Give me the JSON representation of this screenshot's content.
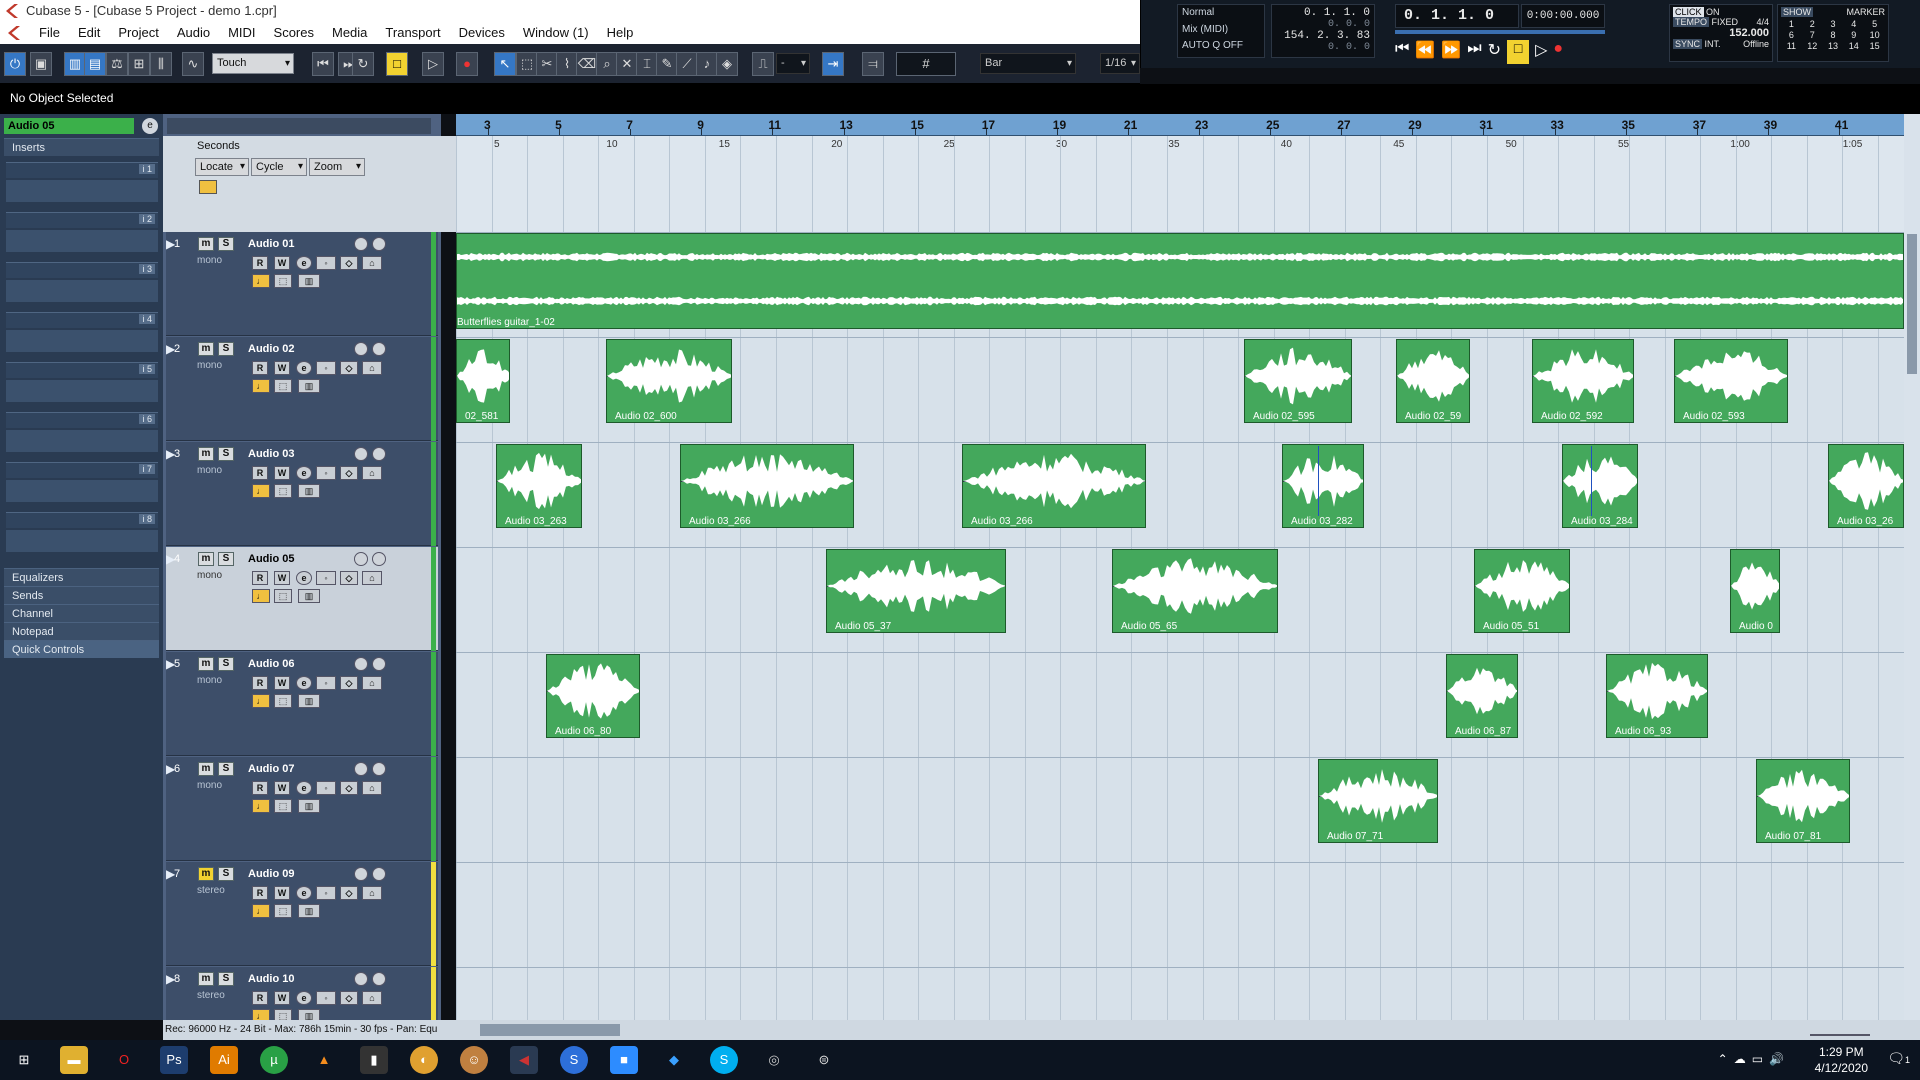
{
  "window_title": "Cubase 5 - [Cubase 5 Project - demo 1.cpr]",
  "menu": [
    "File",
    "Edit",
    "Project",
    "Audio",
    "MIDI",
    "Scores",
    "Media",
    "Transport",
    "Devices",
    "Window (1)",
    "Help"
  ],
  "toolbar": {
    "automation_mode": "Touch",
    "grid_type": "Bar",
    "quantize": "1/16",
    "quantize_dash": "-"
  },
  "transport": {
    "mode": "Normal",
    "mix": "Mix (MIDI)",
    "auto_q": "AUTO Q",
    "auto_q_state": "OFF",
    "left_locator": "0. 1. 1.   0",
    "left_sub": "0.   0.   0",
    "right_locator": "154.  2.  3. 83",
    "right_sub": "0.   0.   0",
    "position_bars": "0.  1.  1.    0",
    "position_time": "0:00:00.000",
    "click_label": "CLICK",
    "click_state": "ON",
    "tempo_label": "TEMPO",
    "tempo_mode": "FIXED",
    "signature": "4/4",
    "tempo": "152.000",
    "sync_label": "SYNC",
    "sync_mode": "INT.",
    "sync_state": "Offline",
    "show_label": "SHOW",
    "marker_label": "MARKER",
    "markers": [
      "1",
      "2",
      "3",
      "4",
      "5",
      "6",
      "7",
      "8",
      "9",
      "10",
      "11",
      "12",
      "13",
      "14",
      "15"
    ]
  },
  "status": "No Object Selected",
  "inspector": {
    "track_name": "Audio 05",
    "inserts_label": "Inserts",
    "slots": [
      "i 1",
      "i 2",
      "i 3",
      "i 4",
      "i 5",
      "i 6",
      "i 7",
      "i 8"
    ],
    "sections": [
      "Equalizers",
      "Sends",
      "Channel",
      "Notepad",
      "Quick Controls"
    ]
  },
  "ruler": {
    "bars": [
      "3",
      "5",
      "7",
      "9",
      "11",
      "13",
      "15",
      "17",
      "19",
      "21",
      "23",
      "25",
      "27",
      "29",
      "31",
      "33",
      "35",
      "37",
      "39",
      "41"
    ],
    "seconds": [
      "5",
      "10",
      "15",
      "20",
      "25",
      "30",
      "35",
      "40",
      "45",
      "50",
      "55",
      "1:00",
      "1:05"
    ],
    "seconds_label": "Seconds",
    "locate": "Locate",
    "cycle": "Cycle",
    "zoom": "Zoom"
  },
  "tracks": [
    {
      "num": "1",
      "name": "Audio 01",
      "type": "mono",
      "color": "#3bb04a"
    },
    {
      "num": "2",
      "name": "Audio 02",
      "type": "mono",
      "color": "#3bb04a"
    },
    {
      "num": "3",
      "name": "Audio 03",
      "type": "mono",
      "color": "#3bb04a"
    },
    {
      "num": "4",
      "name": "Audio 05",
      "type": "mono",
      "color": "#3bb04a"
    },
    {
      "num": "5",
      "name": "Audio 06",
      "type": "mono",
      "color": "#3bb04a"
    },
    {
      "num": "6",
      "name": "Audio 07",
      "type": "mono",
      "color": "#3bb04a"
    },
    {
      "num": "7",
      "name": "Audio 09",
      "type": "stereo",
      "color": "#f2e040"
    },
    {
      "num": "8",
      "name": "Audio 10",
      "type": "stereo",
      "color": "#f2e040"
    }
  ],
  "events": [
    {
      "lane": 0,
      "name": "Butterflies guitar_1-02"
    },
    {
      "lane": 1,
      "name": "02_581"
    },
    {
      "lane": 1,
      "name": "Audio 02_600"
    },
    {
      "lane": 1,
      "name": "Audio 02_595"
    },
    {
      "lane": 1,
      "name": "Audio 02_59"
    },
    {
      "lane": 1,
      "name": "Audio 02_592"
    },
    {
      "lane": 1,
      "name": "Audio 02_593"
    },
    {
      "lane": 2,
      "name": "Audio 03_263"
    },
    {
      "lane": 2,
      "name": "Audio 03_266"
    },
    {
      "lane": 2,
      "name": "Audio 03_266"
    },
    {
      "lane": 2,
      "name": "Audio 03_282"
    },
    {
      "lane": 2,
      "name": "Audio 03_284"
    },
    {
      "lane": 2,
      "name": "Audio 03_26"
    },
    {
      "lane": 3,
      "name": "Audio 05_37"
    },
    {
      "lane": 3,
      "name": "Audio 05_65"
    },
    {
      "lane": 3,
      "name": "Audio 05_51"
    },
    {
      "lane": 3,
      "name": "Audio 0"
    },
    {
      "lane": 4,
      "name": "Audio 06_80"
    },
    {
      "lane": 4,
      "name": "Audio 06_87"
    },
    {
      "lane": 4,
      "name": "Audio 06_93"
    },
    {
      "lane": 5,
      "name": "Audio 07_71"
    },
    {
      "lane": 5,
      "name": "Audio 07_81"
    }
  ],
  "status_bar": "Rec: 96000 Hz - 24 Bit - Max: 786h 15min - 30 fps - Pan: Equ",
  "taskbar": {
    "time": "1:29 PM",
    "date": "4/12/2020",
    "notifications": "1"
  }
}
